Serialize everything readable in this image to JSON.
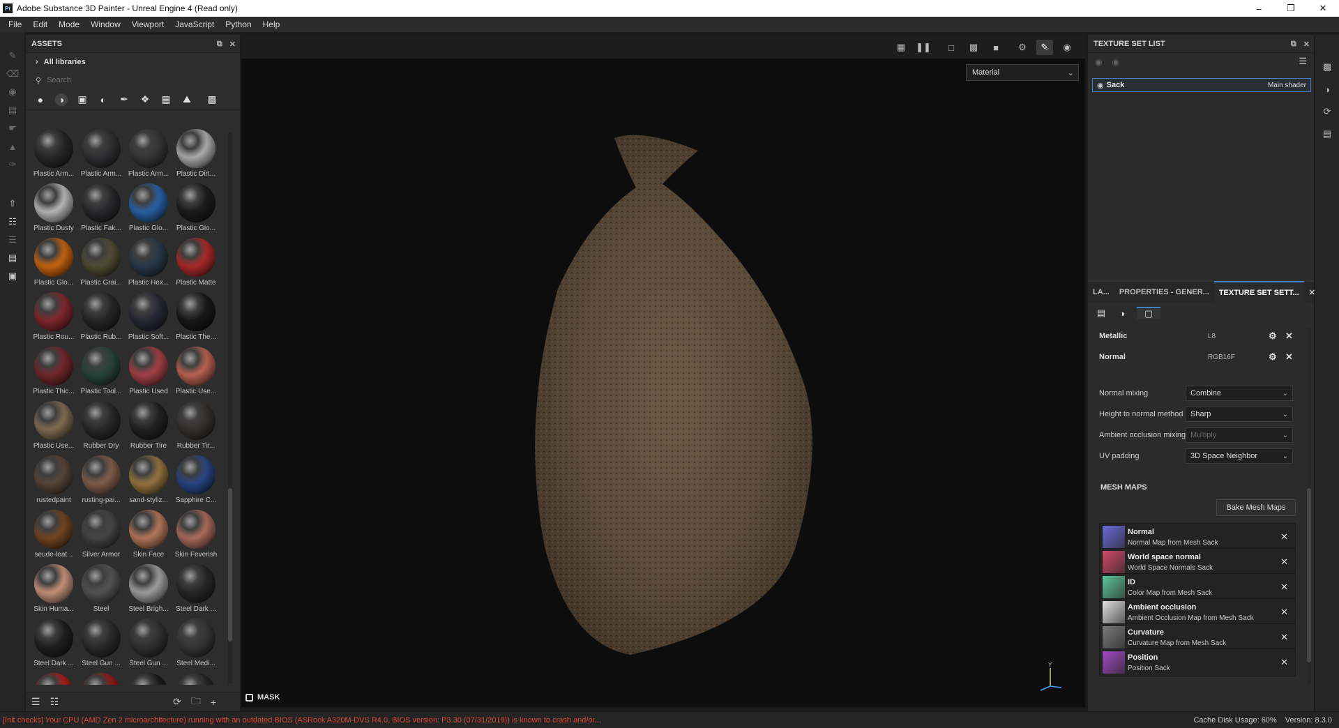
{
  "window": {
    "title": "Adobe Substance 3D Painter - Unreal Engine 4 (Read only)",
    "logo": "Pt"
  },
  "menu": [
    "File",
    "Edit",
    "Mode",
    "Window",
    "Viewport",
    "JavaScript",
    "Python",
    "Help"
  ],
  "assets": {
    "title": "ASSETS",
    "library": "All libraries",
    "search_placeholder": "Search",
    "items": [
      {
        "label": "Plastic Arm...",
        "color": "#2a2a2c"
      },
      {
        "label": "Plastic Arm...",
        "color": "#333336"
      },
      {
        "label": "Plastic Arm...",
        "color": "#3a3a3c"
      },
      {
        "label": "Plastic Dirt...",
        "color": "#b9b9b9"
      },
      {
        "label": "Plastic Dusty",
        "color": "#c4c4c4"
      },
      {
        "label": "Plastic Fak...",
        "color": "#2c2c30"
      },
      {
        "label": "Plastic Glo...",
        "color": "#2c68b0"
      },
      {
        "label": "Plastic Glo...",
        "color": "#1e1e20"
      },
      {
        "label": "Plastic Glo...",
        "color": "#d46a12"
      },
      {
        "label": "Plastic Grai...",
        "color": "#565236"
      },
      {
        "label": "Plastic Hex...",
        "color": "#2b3d4e"
      },
      {
        "label": "Plastic Matte",
        "color": "#b72d2d"
      },
      {
        "label": "Plastic Rou...",
        "color": "#8a2a30"
      },
      {
        "label": "Plastic Rub...",
        "color": "#2a2a2c"
      },
      {
        "label": "Plastic Soft...",
        "color": "#2c2c3a"
      },
      {
        "label": "Plastic The...",
        "color": "#1a1a1c"
      },
      {
        "label": "Plastic Thic...",
        "color": "#7a2a2e"
      },
      {
        "label": "Plastic Tool...",
        "color": "#2a4a3e"
      },
      {
        "label": "Plastic Used",
        "color": "#b0464c"
      },
      {
        "label": "Plastic Use...",
        "color": "#c86a58"
      },
      {
        "label": "Plastic Use...",
        "color": "#8a7458"
      },
      {
        "label": "Rubber Dry",
        "color": "#2c2c2c"
      },
      {
        "label": "Rubber Tire",
        "color": "#242424"
      },
      {
        "label": "Rubber Tir...",
        "color": "#3a3432"
      },
      {
        "label": "rustedpaint",
        "color": "#5e4a3c"
      },
      {
        "label": "rusting-pai...",
        "color": "#8a6450"
      },
      {
        "label": "sand-styliz...",
        "color": "#a07c44"
      },
      {
        "label": "Sapphire C...",
        "color": "#2c4a8c"
      },
      {
        "label": "seude-leat...",
        "color": "#7a4a24"
      },
      {
        "label": "Silver Armor",
        "color": "#4a4a4c"
      },
      {
        "label": "Skin Face",
        "color": "#c08060"
      },
      {
        "label": "Skin Feverish",
        "color": "#b87464"
      },
      {
        "label": "Skin Huma...",
        "color": "#d49c84"
      },
      {
        "label": "Steel",
        "color": "#5a5a5c"
      },
      {
        "label": "Steel Brigh...",
        "color": "#aaaaaa"
      },
      {
        "label": "Steel Dark ...",
        "color": "#2a2a2a"
      },
      {
        "label": "Steel Dark ...",
        "color": "#222222"
      },
      {
        "label": "Steel Gun ...",
        "color": "#2e2e30"
      },
      {
        "label": "Steel Gun ...",
        "color": "#343436"
      },
      {
        "label": "Steel Medi...",
        "color": "#3a3a3c"
      },
      {
        "label": "",
        "color": "#b82020"
      },
      {
        "label": "",
        "color": "#a01a1a"
      },
      {
        "label": "",
        "color": "#1e1e1e"
      },
      {
        "label": "",
        "color": "#282828"
      }
    ]
  },
  "viewport": {
    "mode_select": "Material",
    "mask_label": "MASK"
  },
  "texture_set_list": {
    "title": "TEXTURE SET LIST",
    "set_name": "Sack",
    "shader": "Main shader"
  },
  "tabs": [
    "LA...",
    "PROPERTIES - GENER...",
    "TEXTURE SET SETT..."
  ],
  "channels": [
    {
      "name": "Metallic",
      "format": "L8"
    },
    {
      "name": "Normal",
      "format": "RGB16F"
    }
  ],
  "props": [
    {
      "label": "Normal mixing",
      "value": "Combine",
      "disabled": false
    },
    {
      "label": "Height to normal method",
      "value": "Sharp",
      "disabled": false
    },
    {
      "label": "Ambient occlusion mixing",
      "value": "Multiply",
      "disabled": true
    },
    {
      "label": "UV padding",
      "value": "3D Space Neighbor",
      "disabled": false
    }
  ],
  "mesh_maps": {
    "title": "MESH MAPS",
    "bake_label": "Bake Mesh Maps",
    "items": [
      {
        "name": "Normal",
        "desc": "Normal Map from Mesh Sack",
        "thumb": "#6a6ad6"
      },
      {
        "name": "World space normal",
        "desc": "World Space Normals Sack",
        "thumb": "#d04a6a"
      },
      {
        "name": "ID",
        "desc": "Color Map from Mesh Sack",
        "thumb": "#5ec49a"
      },
      {
        "name": "Ambient occlusion",
        "desc": "Ambient Occlusion Map from Mesh Sack",
        "thumb": "#e0e0e0"
      },
      {
        "name": "Curvature",
        "desc": "Curvature Map from Mesh Sack",
        "thumb": "#7a7a7a"
      },
      {
        "name": "Position",
        "desc": "Position Sack",
        "thumb": "#a04ac0"
      }
    ]
  },
  "status": {
    "message": "[Init checks] Your CPU (AMD Zen 2 microarchitecture) running with an outdated BIOS (ASRock A320M-DVS R4.0, BIOS version: P3.30 (07/31/2019)) is known to crash and/or...",
    "cache": "Cache Disk Usage:   60%",
    "version": "Version: 8.3.0"
  }
}
